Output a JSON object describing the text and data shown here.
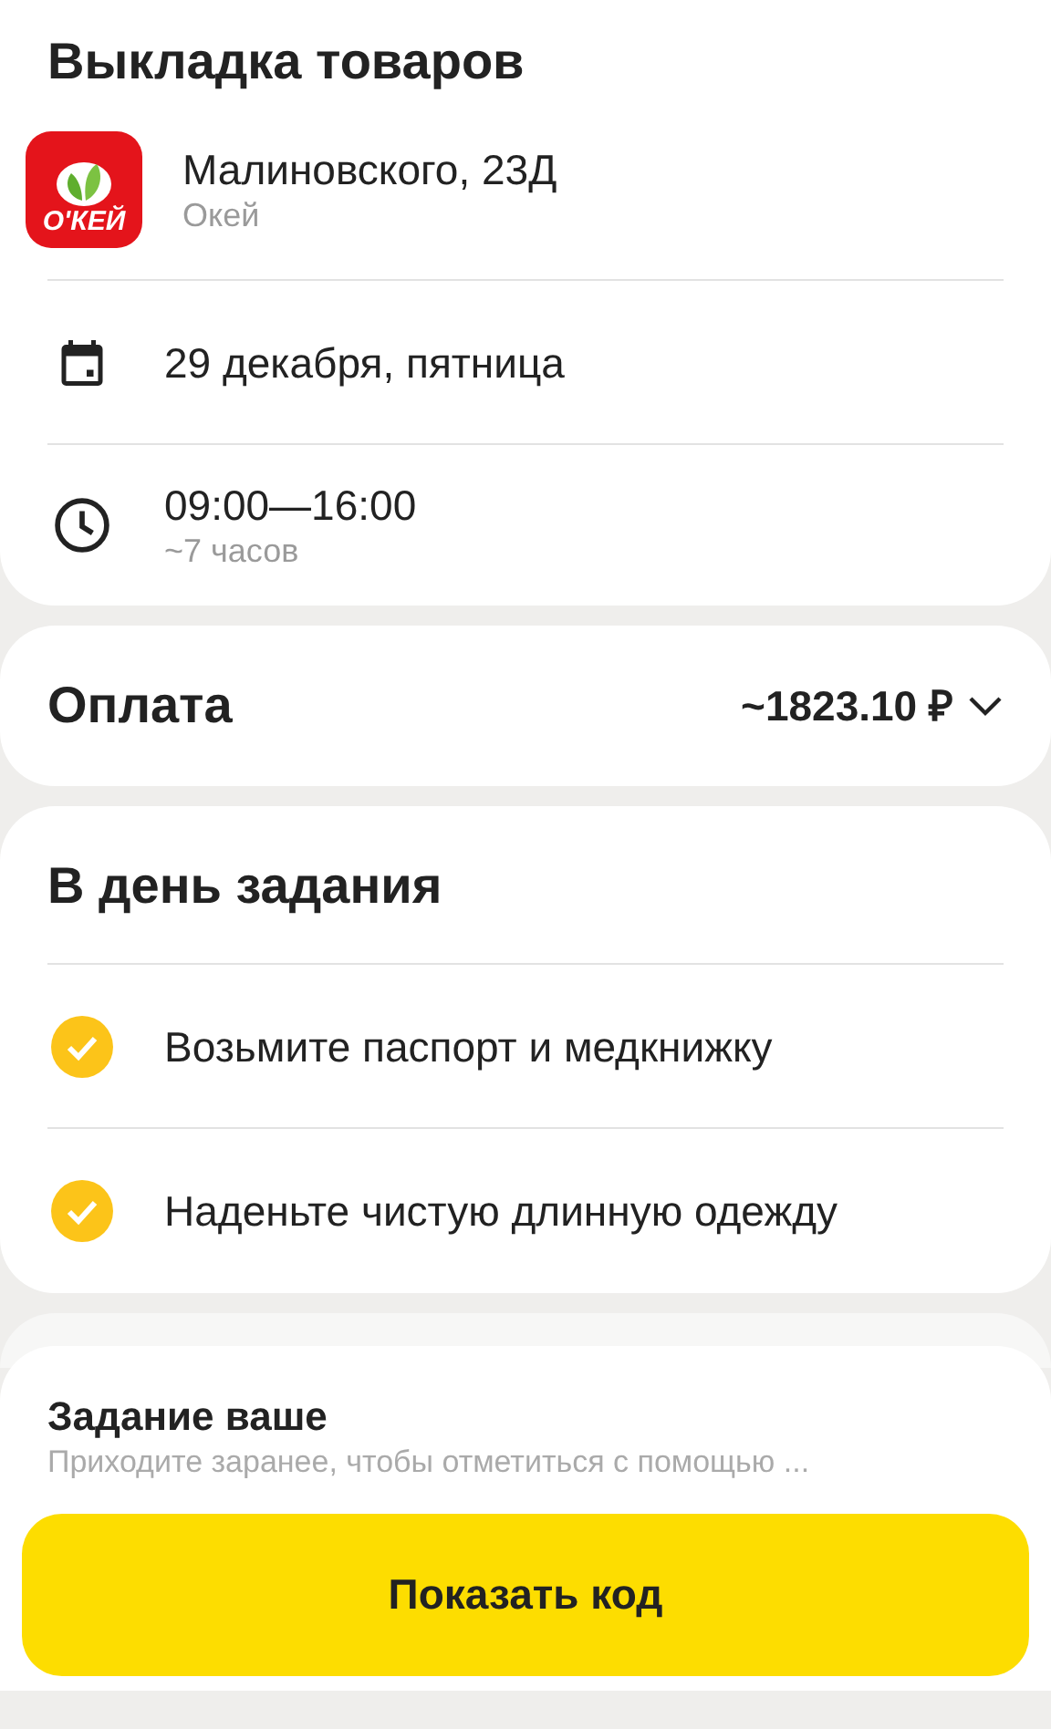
{
  "title": "Выкладка товаров",
  "store": {
    "logo_text": "О'КЕЙ",
    "address": "Малиновского, 23Д",
    "name": "Окей"
  },
  "date": "29 декабря, пятница",
  "time": {
    "range": "09:00—16:00",
    "duration": "~7 часов"
  },
  "payment": {
    "label": "Оплата",
    "amount": "~1823.10 ₽"
  },
  "day_of_task": {
    "title": "В день задания",
    "items": [
      {
        "text": "Возьмите паспорт и медкнижку",
        "checked": true
      },
      {
        "text": "Наденьте чистую длинную одежду",
        "checked": true
      }
    ]
  },
  "sheet": {
    "title": "Задание ваше",
    "subtitle": "Приходите заранее, чтобы отметиться с помощью ...",
    "button": "Показать код"
  }
}
